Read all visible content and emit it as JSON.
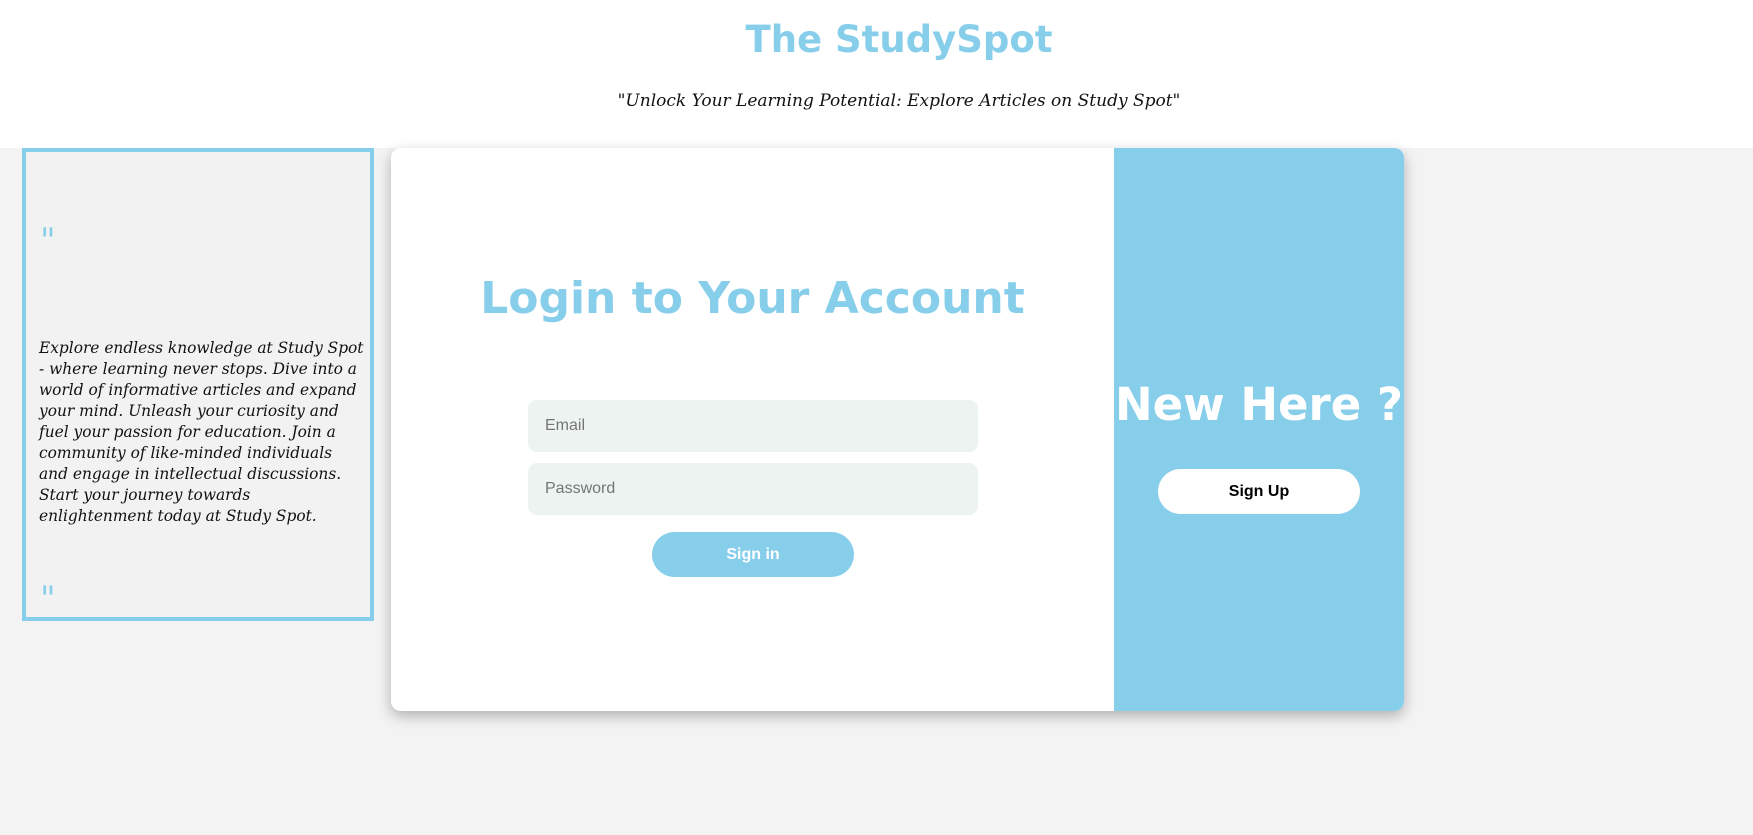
{
  "header": {
    "title": "The StudySpot",
    "tagline": "\"Unlock Your Learning Potential: Explore Articles on Study Spot\""
  },
  "quote": {
    "open_mark": "\"",
    "text": "Explore endless knowledge at Study Spot - where learning never stops. Dive into a world of informative articles and expand your mind. Unleash your curiosity and fuel your passion for education. Join a community of like-minded individuals and engage in intellectual discussions. Start your journey towards enlightenment today at Study Spot.",
    "close_mark": "\""
  },
  "login": {
    "title": "Login to Your Account",
    "email_placeholder": "Email",
    "email_value": "",
    "password_placeholder": "Password",
    "password_value": "",
    "signin_label": "Sign in"
  },
  "signup": {
    "heading": "New Here ?",
    "button_label": "Sign Up"
  },
  "colors": {
    "accent": "#87ceeb",
    "page_background": "#f3f3f3",
    "input_background": "#ecf3f1",
    "button_text_dark": "#000000",
    "button_text_light": "#ffffff"
  }
}
